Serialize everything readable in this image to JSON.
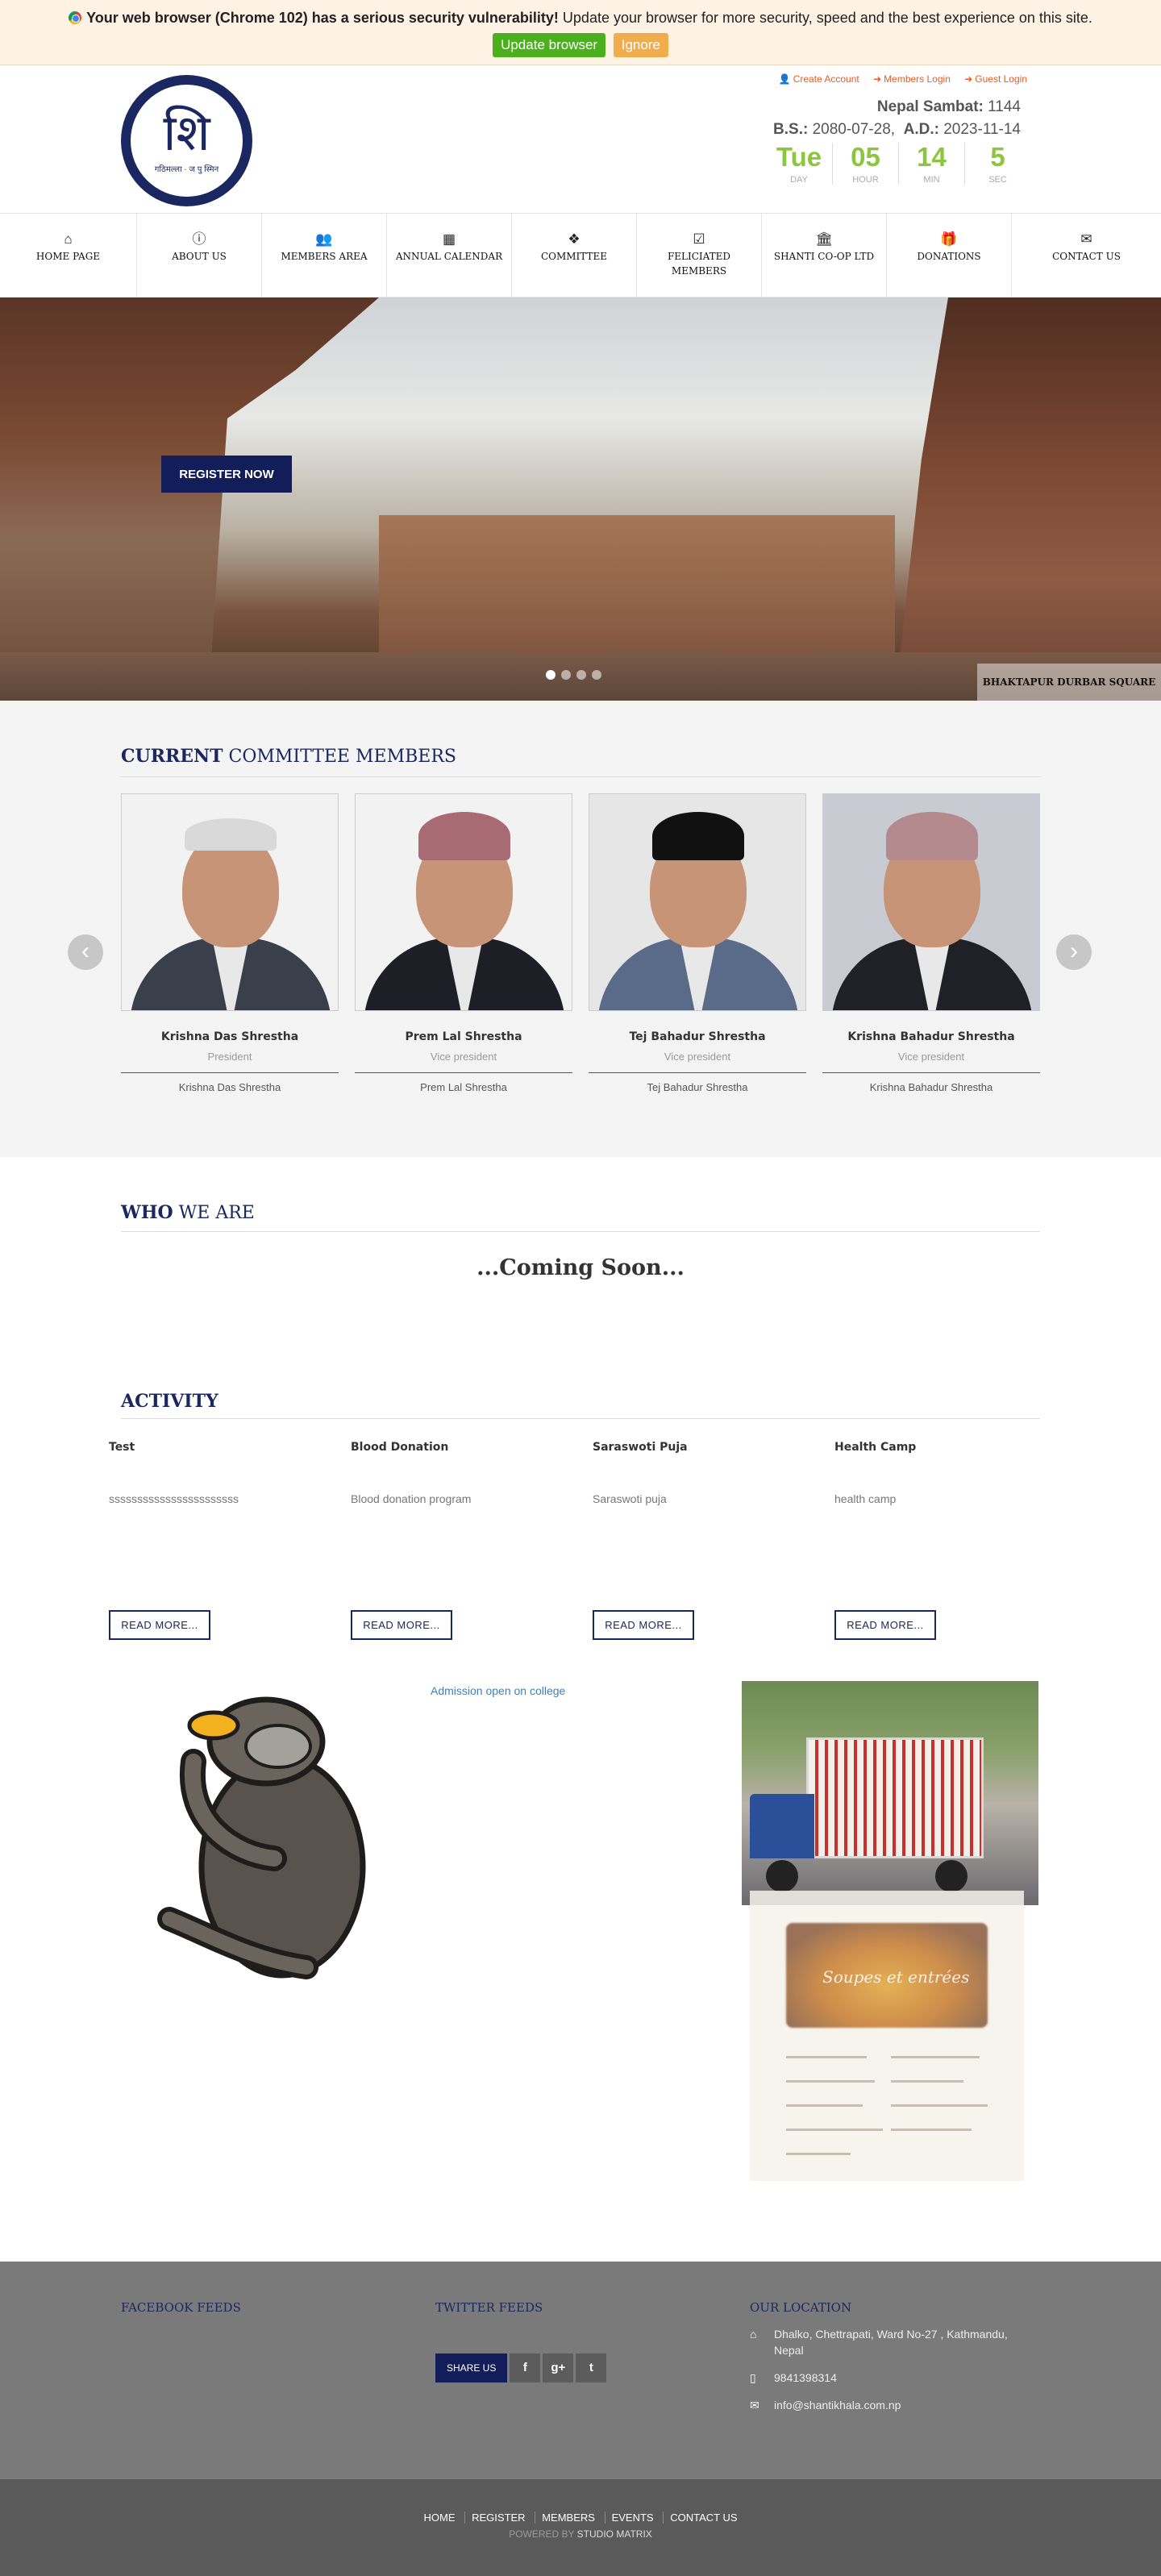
{
  "warning": {
    "bold": "Your web browser (Chrome 102) has a serious security vulnerability!",
    "text": " Update your browser for more security, speed and the best experience on this site.",
    "update_label": "Update browser",
    "ignore_label": "Ignore"
  },
  "header": {
    "logo_glyph": "शि",
    "logo_caption": "गठिमल्ला · ज पु स्मिन",
    "toplinks": [
      "Create Account",
      "Members Login",
      "Guest Login"
    ],
    "nepal_sambat_label": "Nepal Sambat:",
    "nepal_sambat_value": "1144",
    "bs_label": "B.S.:",
    "bs_value": "2080-07-28,",
    "ad_label": "A.D.:",
    "ad_value": "2023-11-14",
    "countdown": [
      {
        "value": "Tue",
        "label": "DAY"
      },
      {
        "value": "05",
        "label": "HOUR"
      },
      {
        "value": "14",
        "label": "MIN"
      },
      {
        "value": "5",
        "label": "SEC"
      }
    ]
  },
  "nav": [
    {
      "label": "HOME PAGE",
      "icon": "home-icon"
    },
    {
      "label": "ABOUT US",
      "icon": "info-icon"
    },
    {
      "label": "MEMBERS AREA",
      "icon": "users-icon"
    },
    {
      "label": "ANNUAL CALENDAR",
      "icon": "calendar-icon"
    },
    {
      "label": "COMMITTEE",
      "icon": "cubes-icon"
    },
    {
      "label": "FELICIATED MEMBERS",
      "icon": "check-icon"
    },
    {
      "label": "SHANTI CO-OP LTD",
      "icon": "bank-icon"
    },
    {
      "label": "DONATIONS",
      "icon": "gift-icon"
    },
    {
      "label": "CONTACT US",
      "icon": "envelope-icon"
    }
  ],
  "hero": {
    "register_label": "REGISTER NOW",
    "caption": "BHAKTAPUR DURBAR SQUARE",
    "slide_count": 4,
    "active_slide": 1
  },
  "committee": {
    "title_bold": "CURRENT",
    "title_rest": " COMMITTEE MEMBERS",
    "members": [
      {
        "name": "Krishna Das Shrestha",
        "role": "President",
        "caption": "Krishna Das Shrestha",
        "hat": "none",
        "colors": {
          "bg": "#f2f2f2",
          "suit": "#3a3f4c",
          "hair": "#d9d9d9"
        }
      },
      {
        "name": "Prem Lal Shrestha",
        "role": "Vice president",
        "caption": "Prem Lal Shrestha",
        "hat": "dhaka-topi",
        "colors": {
          "bg": "#f2f2f2",
          "suit": "#1e1f26",
          "hat": "#a86b73"
        }
      },
      {
        "name": "Tej Bahadur Shrestha",
        "role": "Vice president",
        "caption": "Tej Bahadur Shrestha",
        "hat": "black-topi",
        "colors": {
          "bg": "#e6e6e6",
          "suit": "#5a6b8a",
          "hat": "#111111"
        }
      },
      {
        "name": "Krishna Bahadur Shrestha",
        "role": "Vice president",
        "caption": "Krishna Bahadur Shrestha",
        "hat": "dhaka-topi",
        "colors": {
          "bg": "#c8ccd2",
          "suit": "#1f2127",
          "hat": "#b48a8e"
        }
      }
    ]
  },
  "who": {
    "title_bold": "WHO",
    "title_rest": " WE ARE",
    "coming_soon": "...Coming Soon..."
  },
  "activity": {
    "title": "ACTIVITY",
    "items": [
      {
        "title": "Test",
        "text": "sssssssssssssssssssssss",
        "button": "READ MORE..."
      },
      {
        "title": "Blood Donation",
        "text": "Blood donation program",
        "button": "READ MORE..."
      },
      {
        "title": "Saraswoti Puja",
        "text": "Saraswoti puja",
        "button": "READ MORE..."
      },
      {
        "title": "Health Camp",
        "text": "health camp",
        "button": "READ MORE..."
      }
    ]
  },
  "media": {
    "admission_link": "Admission open on college",
    "menu_heading": "Soupes et entrées"
  },
  "footer": {
    "facebook_title": "FACEBOOK FEEDS",
    "twitter_title": "TWITTER FEEDS",
    "location_title": "OUR LOCATION",
    "share_label": "SHARE US",
    "share_icons": [
      "facebook-icon",
      "google-plus-icon",
      "twitter-icon"
    ],
    "address": "Dhalko, Chettrapati, Ward No-27 , Kathmandu, Nepal",
    "phone": "9841398314",
    "email": "info@shantikhala.com.np"
  },
  "bottom": {
    "links": [
      "HOME",
      "REGISTER",
      "MEMBERS",
      "EVENTS",
      "CONTACT US"
    ],
    "powered_prefix": "POWERED BY ",
    "powered_by": "STUDIO MATRIX"
  },
  "colors": {
    "brand_navy": "#1b2760",
    "accent_orange": "#e85d24",
    "countdown_green": "#8cc63f",
    "update_green": "#4caf1e",
    "ignore_orange": "#f0ad4e"
  }
}
